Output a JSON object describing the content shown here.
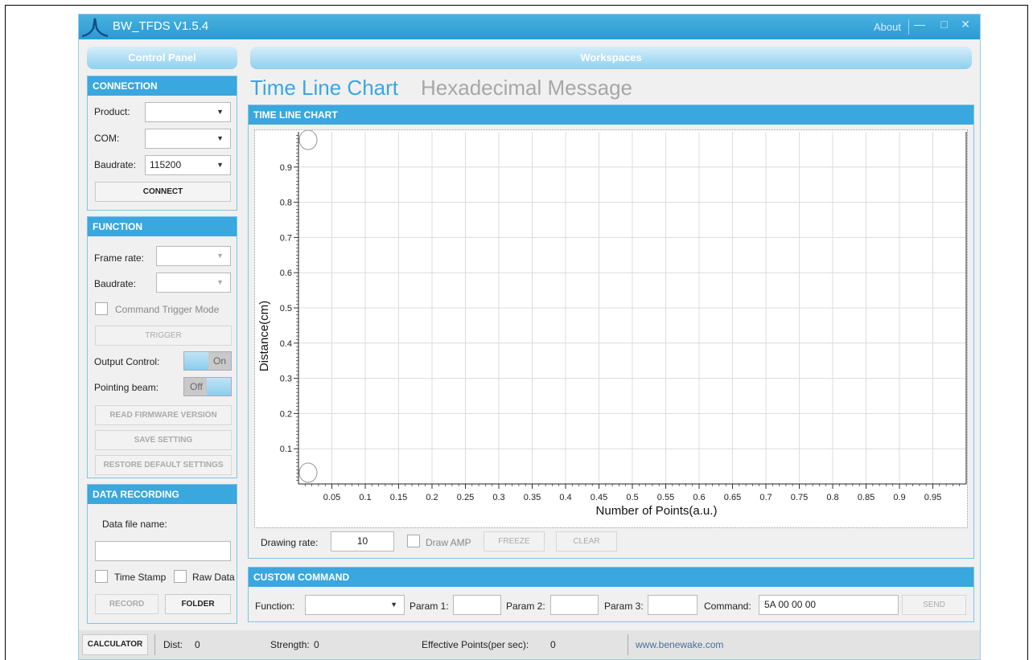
{
  "window": {
    "title": "BW_TFDS V1.5.4",
    "about": "About",
    "minimize_glyph": "—",
    "maximize_glyph": "□",
    "close_glyph": "✕"
  },
  "colors": {
    "accent": "#3aa7de",
    "title_bar": "#2a9bd3",
    "inactive_tab": "#a7a7a7"
  },
  "control_panel": {
    "title": "Control Panel",
    "connection": {
      "header": "CONNECTION",
      "product_label": "Product:",
      "product_value": "",
      "com_label": "COM:",
      "com_value": "",
      "baudrate_label": "Baudrate:",
      "baudrate_value": "115200",
      "connect_button": "CONNECT"
    },
    "function": {
      "header": "FUNCTION",
      "frame_rate_label": "Frame rate:",
      "frame_rate_value": "",
      "baudrate_label": "Baudrate:",
      "baudrate_value": "",
      "command_trigger_label": "Command Trigger Mode",
      "trigger_button": "TRIGGER",
      "output_control_label": "Output Control:",
      "output_control_state": "On",
      "pointing_beam_label": "Pointing beam:",
      "pointing_beam_state": "Off",
      "read_firmware_button": "READ FIRMWARE VERSION",
      "save_setting_button": "SAVE SETTING",
      "restore_default_button": "RESTORE DEFAULT SETTINGS"
    },
    "data_recording": {
      "header": "DATA RECORDING",
      "file_name_label": "Data file name:",
      "file_name_value": "",
      "time_stamp_label": "Time Stamp",
      "raw_data_label": "Raw Data",
      "record_button": "RECORD",
      "folder_button": "FOLDER"
    }
  },
  "workspaces": {
    "title": "Workspaces",
    "tabs": [
      {
        "label": "Time Line Chart",
        "active": true
      },
      {
        "label": "Hexadecimal Message",
        "active": false
      }
    ],
    "chart_section_header": "TIME LINE CHART",
    "drawing_rate_label": "Drawing rate:",
    "drawing_rate_value": "10",
    "draw_amp_label": "Draw AMP",
    "freeze_button": "FREEZE",
    "clear_button": "CLEAR"
  },
  "chart_data": {
    "type": "line",
    "title": "",
    "xlabel": "Number of Points(a.u.)",
    "ylabel": "Distance(cm)",
    "xlim": [
      0,
      1
    ],
    "ylim": [
      0,
      1
    ],
    "x_ticks": [
      "0.05",
      "0.1",
      "0.15",
      "0.2",
      "0.25",
      "0.3",
      "0.35",
      "0.4",
      "0.45",
      "0.5",
      "0.55",
      "0.6",
      "0.65",
      "0.7",
      "0.75",
      "0.8",
      "0.85",
      "0.9",
      "0.95"
    ],
    "x_tick_values": [
      0.05,
      0.1,
      0.15,
      0.2,
      0.25,
      0.3,
      0.35,
      0.4,
      0.45,
      0.5,
      0.55,
      0.6,
      0.65,
      0.7,
      0.75,
      0.8,
      0.85,
      0.9,
      0.95
    ],
    "y_ticks": [
      "0.1",
      "0.2",
      "0.3",
      "0.4",
      "0.5",
      "0.6",
      "0.7",
      "0.8",
      "0.9"
    ],
    "y_tick_values": [
      0.1,
      0.2,
      0.3,
      0.4,
      0.5,
      0.6,
      0.7,
      0.8,
      0.9
    ],
    "grid": true,
    "series": []
  },
  "custom_command": {
    "header": "CUSTOM COMMAND",
    "function_label": "Function:",
    "function_value": "",
    "param1_label": "Param 1:",
    "param1_value": "",
    "param2_label": "Param 2:",
    "param2_value": "",
    "param3_label": "Param 3:",
    "param3_value": "",
    "command_label": "Command:",
    "command_value": "5A 00 00 00",
    "send_button": "SEND"
  },
  "status_bar": {
    "calculator_button": "CALCULATOR",
    "dist_label": "Dist:",
    "dist_value": "0",
    "strength_label": "Strength:",
    "strength_value": "0",
    "effective_points_label": "Effective Points(per sec):",
    "effective_points_value": "0",
    "website": "www.benewake.com"
  }
}
